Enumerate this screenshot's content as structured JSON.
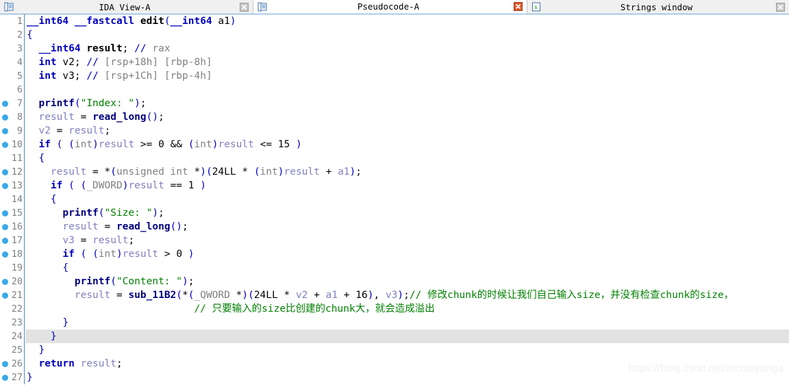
{
  "window": {
    "app": "IDA Pro",
    "watermark": "https://blog.csdn.net/mcmuyanga"
  },
  "tabs": [
    {
      "label": "IDA View-A",
      "icon": "document-blue-icon",
      "close_icon": "close-gray-icon",
      "active": false
    },
    {
      "label": "Pseudocode-A",
      "icon": "document-blue-icon",
      "close_icon": "close-red-icon",
      "active": true
    },
    {
      "label": "Strings window",
      "icon": "strings-green-icon",
      "close_icon": "close-gray-icon",
      "active": false
    }
  ],
  "editor": {
    "highlighted_line": 24,
    "marker_lines": [
      7,
      8,
      9,
      10,
      12,
      13,
      15,
      16,
      17,
      18,
      20,
      21,
      26,
      27
    ],
    "lines": [
      {
        "n": "1",
        "tokens": [
          {
            "t": "__int64",
            "c": "typ"
          },
          {
            "t": " ",
            "c": "plain"
          },
          {
            "t": "__fastcall",
            "c": "typ"
          },
          {
            "t": " ",
            "c": "plain"
          },
          {
            "t": "edit",
            "c": "fndef"
          },
          {
            "t": "(",
            "c": "punc"
          },
          {
            "t": "__int64",
            "c": "typ"
          },
          {
            "t": " ",
            "c": "plain"
          },
          {
            "t": "a1",
            "c": "plain"
          },
          {
            "t": ")",
            "c": "punc"
          }
        ]
      },
      {
        "n": "2",
        "tokens": [
          {
            "t": "{",
            "c": "punc"
          }
        ]
      },
      {
        "n": "3",
        "tokens": [
          {
            "t": "  ",
            "c": "plain"
          },
          {
            "t": "__int64",
            "c": "typ"
          },
          {
            "t": " ",
            "c": "plain"
          },
          {
            "t": "result",
            "c": "fndef"
          },
          {
            "t": ";",
            "c": "op"
          },
          {
            "t": " ",
            "c": "plain"
          },
          {
            "t": "//",
            "c": "punc"
          },
          {
            "t": " rax",
            "c": "cmt"
          }
        ]
      },
      {
        "n": "4",
        "tokens": [
          {
            "t": "  ",
            "c": "plain"
          },
          {
            "t": "int",
            "c": "typ"
          },
          {
            "t": " ",
            "c": "plain"
          },
          {
            "t": "v2",
            "c": "plain"
          },
          {
            "t": ";",
            "c": "op"
          },
          {
            "t": " ",
            "c": "plain"
          },
          {
            "t": "//",
            "c": "punc"
          },
          {
            "t": " [rsp+18h] [rbp-8h]",
            "c": "cmt"
          }
        ]
      },
      {
        "n": "5",
        "tokens": [
          {
            "t": "  ",
            "c": "plain"
          },
          {
            "t": "int",
            "c": "typ"
          },
          {
            "t": " ",
            "c": "plain"
          },
          {
            "t": "v3",
            "c": "plain"
          },
          {
            "t": ";",
            "c": "op"
          },
          {
            "t": " ",
            "c": "plain"
          },
          {
            "t": "//",
            "c": "punc"
          },
          {
            "t": " [rsp+1Ch] [rbp-4h]",
            "c": "cmt"
          }
        ]
      },
      {
        "n": "6",
        "tokens": []
      },
      {
        "n": "7",
        "tokens": [
          {
            "t": "  ",
            "c": "plain"
          },
          {
            "t": "printf",
            "c": "fn"
          },
          {
            "t": "(",
            "c": "punc"
          },
          {
            "t": "\"Index: \"",
            "c": "str"
          },
          {
            "t": ")",
            "c": "punc"
          },
          {
            "t": ";",
            "c": "op"
          }
        ]
      },
      {
        "n": "8",
        "tokens": [
          {
            "t": "  ",
            "c": "plain"
          },
          {
            "t": "result",
            "c": "var"
          },
          {
            "t": " = ",
            "c": "op"
          },
          {
            "t": "read_long",
            "c": "fn"
          },
          {
            "t": "(",
            "c": "punc"
          },
          {
            "t": ")",
            "c": "punc"
          },
          {
            "t": ";",
            "c": "op"
          }
        ]
      },
      {
        "n": "9",
        "tokens": [
          {
            "t": "  ",
            "c": "plain"
          },
          {
            "t": "v2",
            "c": "var"
          },
          {
            "t": " = ",
            "c": "op"
          },
          {
            "t": "result",
            "c": "var"
          },
          {
            "t": ";",
            "c": "op"
          }
        ]
      },
      {
        "n": "10",
        "tokens": [
          {
            "t": "  ",
            "c": "plain"
          },
          {
            "t": "if",
            "c": "k"
          },
          {
            "t": " ",
            "c": "plain"
          },
          {
            "t": "(",
            "c": "punc"
          },
          {
            "t": " ",
            "c": "plain"
          },
          {
            "t": "(",
            "c": "punc"
          },
          {
            "t": "int",
            "c": "cast"
          },
          {
            "t": ")",
            "c": "punc"
          },
          {
            "t": "result",
            "c": "var"
          },
          {
            "t": " >= ",
            "c": "op"
          },
          {
            "t": "0",
            "c": "num"
          },
          {
            "t": " ",
            "c": "plain"
          },
          {
            "t": "&&",
            "c": "op"
          },
          {
            "t": " ",
            "c": "plain"
          },
          {
            "t": "(",
            "c": "punc"
          },
          {
            "t": "int",
            "c": "cast"
          },
          {
            "t": ")",
            "c": "punc"
          },
          {
            "t": "result",
            "c": "var"
          },
          {
            "t": " <= ",
            "c": "op"
          },
          {
            "t": "15",
            "c": "num"
          },
          {
            "t": " ",
            "c": "plain"
          },
          {
            "t": ")",
            "c": "punc"
          }
        ]
      },
      {
        "n": "11",
        "tokens": [
          {
            "t": "  ",
            "c": "plain"
          },
          {
            "t": "{",
            "c": "punc"
          }
        ]
      },
      {
        "n": "12",
        "tokens": [
          {
            "t": "    ",
            "c": "plain"
          },
          {
            "t": "result",
            "c": "var"
          },
          {
            "t": " = ",
            "c": "op"
          },
          {
            "t": "*",
            "c": "op"
          },
          {
            "t": "(",
            "c": "punc"
          },
          {
            "t": "unsigned int",
            "c": "cast"
          },
          {
            "t": " ",
            "c": "plain"
          },
          {
            "t": "*",
            "c": "op"
          },
          {
            "t": ")",
            "c": "punc"
          },
          {
            "t": "(",
            "c": "punc"
          },
          {
            "t": "24LL",
            "c": "num"
          },
          {
            "t": " * ",
            "c": "op"
          },
          {
            "t": "(",
            "c": "punc"
          },
          {
            "t": "int",
            "c": "cast"
          },
          {
            "t": ")",
            "c": "punc"
          },
          {
            "t": "result",
            "c": "var"
          },
          {
            "t": " + ",
            "c": "op"
          },
          {
            "t": "a1",
            "c": "arg"
          },
          {
            "t": ")",
            "c": "punc"
          },
          {
            "t": ";",
            "c": "op"
          }
        ]
      },
      {
        "n": "13",
        "tokens": [
          {
            "t": "    ",
            "c": "plain"
          },
          {
            "t": "if",
            "c": "k"
          },
          {
            "t": " ",
            "c": "plain"
          },
          {
            "t": "(",
            "c": "punc"
          },
          {
            "t": " ",
            "c": "plain"
          },
          {
            "t": "(",
            "c": "punc"
          },
          {
            "t": "_DWORD",
            "c": "cast"
          },
          {
            "t": ")",
            "c": "punc"
          },
          {
            "t": "result",
            "c": "var"
          },
          {
            "t": " == ",
            "c": "op"
          },
          {
            "t": "1",
            "c": "num"
          },
          {
            "t": " ",
            "c": "plain"
          },
          {
            "t": ")",
            "c": "punc"
          }
        ]
      },
      {
        "n": "14",
        "tokens": [
          {
            "t": "    ",
            "c": "plain"
          },
          {
            "t": "{",
            "c": "punc"
          }
        ]
      },
      {
        "n": "15",
        "tokens": [
          {
            "t": "      ",
            "c": "plain"
          },
          {
            "t": "printf",
            "c": "fn"
          },
          {
            "t": "(",
            "c": "punc"
          },
          {
            "t": "\"Size: \"",
            "c": "str"
          },
          {
            "t": ")",
            "c": "punc"
          },
          {
            "t": ";",
            "c": "op"
          }
        ]
      },
      {
        "n": "16",
        "tokens": [
          {
            "t": "      ",
            "c": "plain"
          },
          {
            "t": "result",
            "c": "var"
          },
          {
            "t": " = ",
            "c": "op"
          },
          {
            "t": "read_long",
            "c": "fn"
          },
          {
            "t": "(",
            "c": "punc"
          },
          {
            "t": ")",
            "c": "punc"
          },
          {
            "t": ";",
            "c": "op"
          }
        ]
      },
      {
        "n": "17",
        "tokens": [
          {
            "t": "      ",
            "c": "plain"
          },
          {
            "t": "v3",
            "c": "var"
          },
          {
            "t": " = ",
            "c": "op"
          },
          {
            "t": "result",
            "c": "var"
          },
          {
            "t": ";",
            "c": "op"
          }
        ]
      },
      {
        "n": "18",
        "tokens": [
          {
            "t": "      ",
            "c": "plain"
          },
          {
            "t": "if",
            "c": "k"
          },
          {
            "t": " ",
            "c": "plain"
          },
          {
            "t": "(",
            "c": "punc"
          },
          {
            "t": " ",
            "c": "plain"
          },
          {
            "t": "(",
            "c": "punc"
          },
          {
            "t": "int",
            "c": "cast"
          },
          {
            "t": ")",
            "c": "punc"
          },
          {
            "t": "result",
            "c": "var"
          },
          {
            "t": " > ",
            "c": "op"
          },
          {
            "t": "0",
            "c": "num"
          },
          {
            "t": " ",
            "c": "plain"
          },
          {
            "t": ")",
            "c": "punc"
          }
        ]
      },
      {
        "n": "19",
        "tokens": [
          {
            "t": "      ",
            "c": "plain"
          },
          {
            "t": "{",
            "c": "punc"
          }
        ]
      },
      {
        "n": "20",
        "tokens": [
          {
            "t": "        ",
            "c": "plain"
          },
          {
            "t": "printf",
            "c": "fn"
          },
          {
            "t": "(",
            "c": "punc"
          },
          {
            "t": "\"Content: \"",
            "c": "str"
          },
          {
            "t": ")",
            "c": "punc"
          },
          {
            "t": ";",
            "c": "op"
          }
        ]
      },
      {
        "n": "21",
        "tokens": [
          {
            "t": "        ",
            "c": "plain"
          },
          {
            "t": "result",
            "c": "var"
          },
          {
            "t": " = ",
            "c": "op"
          },
          {
            "t": "sub_11B2",
            "c": "fn"
          },
          {
            "t": "(",
            "c": "punc"
          },
          {
            "t": "*",
            "c": "op"
          },
          {
            "t": "(",
            "c": "punc"
          },
          {
            "t": "_QWORD",
            "c": "cast"
          },
          {
            "t": " ",
            "c": "plain"
          },
          {
            "t": "*",
            "c": "op"
          },
          {
            "t": ")",
            "c": "punc"
          },
          {
            "t": "(",
            "c": "punc"
          },
          {
            "t": "24LL",
            "c": "num"
          },
          {
            "t": " * ",
            "c": "op"
          },
          {
            "t": "v2",
            "c": "var"
          },
          {
            "t": " + ",
            "c": "op"
          },
          {
            "t": "a1",
            "c": "arg"
          },
          {
            "t": " + ",
            "c": "op"
          },
          {
            "t": "16",
            "c": "num"
          },
          {
            "t": ")",
            "c": "punc"
          },
          {
            "t": ", ",
            "c": "op"
          },
          {
            "t": "v3",
            "c": "var"
          },
          {
            "t": ")",
            "c": "punc"
          },
          {
            "t": ";",
            "c": "op"
          },
          {
            "t": "//",
            "c": "cmtg"
          },
          {
            "t": " 修改chunk的时候让我们自己输入size，并没有检查chunk的size，",
            "c": "cmtg"
          }
        ]
      },
      {
        "n": "22",
        "tokens": [
          {
            "t": "                            ",
            "c": "plain"
          },
          {
            "t": "//",
            "c": "cmtg"
          },
          {
            "t": " 只要输入的size比创建的chunk大，就会造成溢出",
            "c": "cmtg"
          }
        ]
      },
      {
        "n": "23",
        "tokens": [
          {
            "t": "      ",
            "c": "plain"
          },
          {
            "t": "}",
            "c": "punc"
          }
        ]
      },
      {
        "n": "24",
        "tokens": [
          {
            "t": "    ",
            "c": "plain"
          },
          {
            "t": "}",
            "c": "punc"
          }
        ]
      },
      {
        "n": "25",
        "tokens": [
          {
            "t": "  ",
            "c": "plain"
          },
          {
            "t": "}",
            "c": "punc"
          }
        ]
      },
      {
        "n": "26",
        "tokens": [
          {
            "t": "  ",
            "c": "plain"
          },
          {
            "t": "return",
            "c": "k"
          },
          {
            "t": " ",
            "c": "plain"
          },
          {
            "t": "result",
            "c": "var"
          },
          {
            "t": ";",
            "c": "op"
          }
        ]
      },
      {
        "n": "27",
        "tokens": [
          {
            "t": "}",
            "c": "punc"
          }
        ]
      }
    ]
  }
}
